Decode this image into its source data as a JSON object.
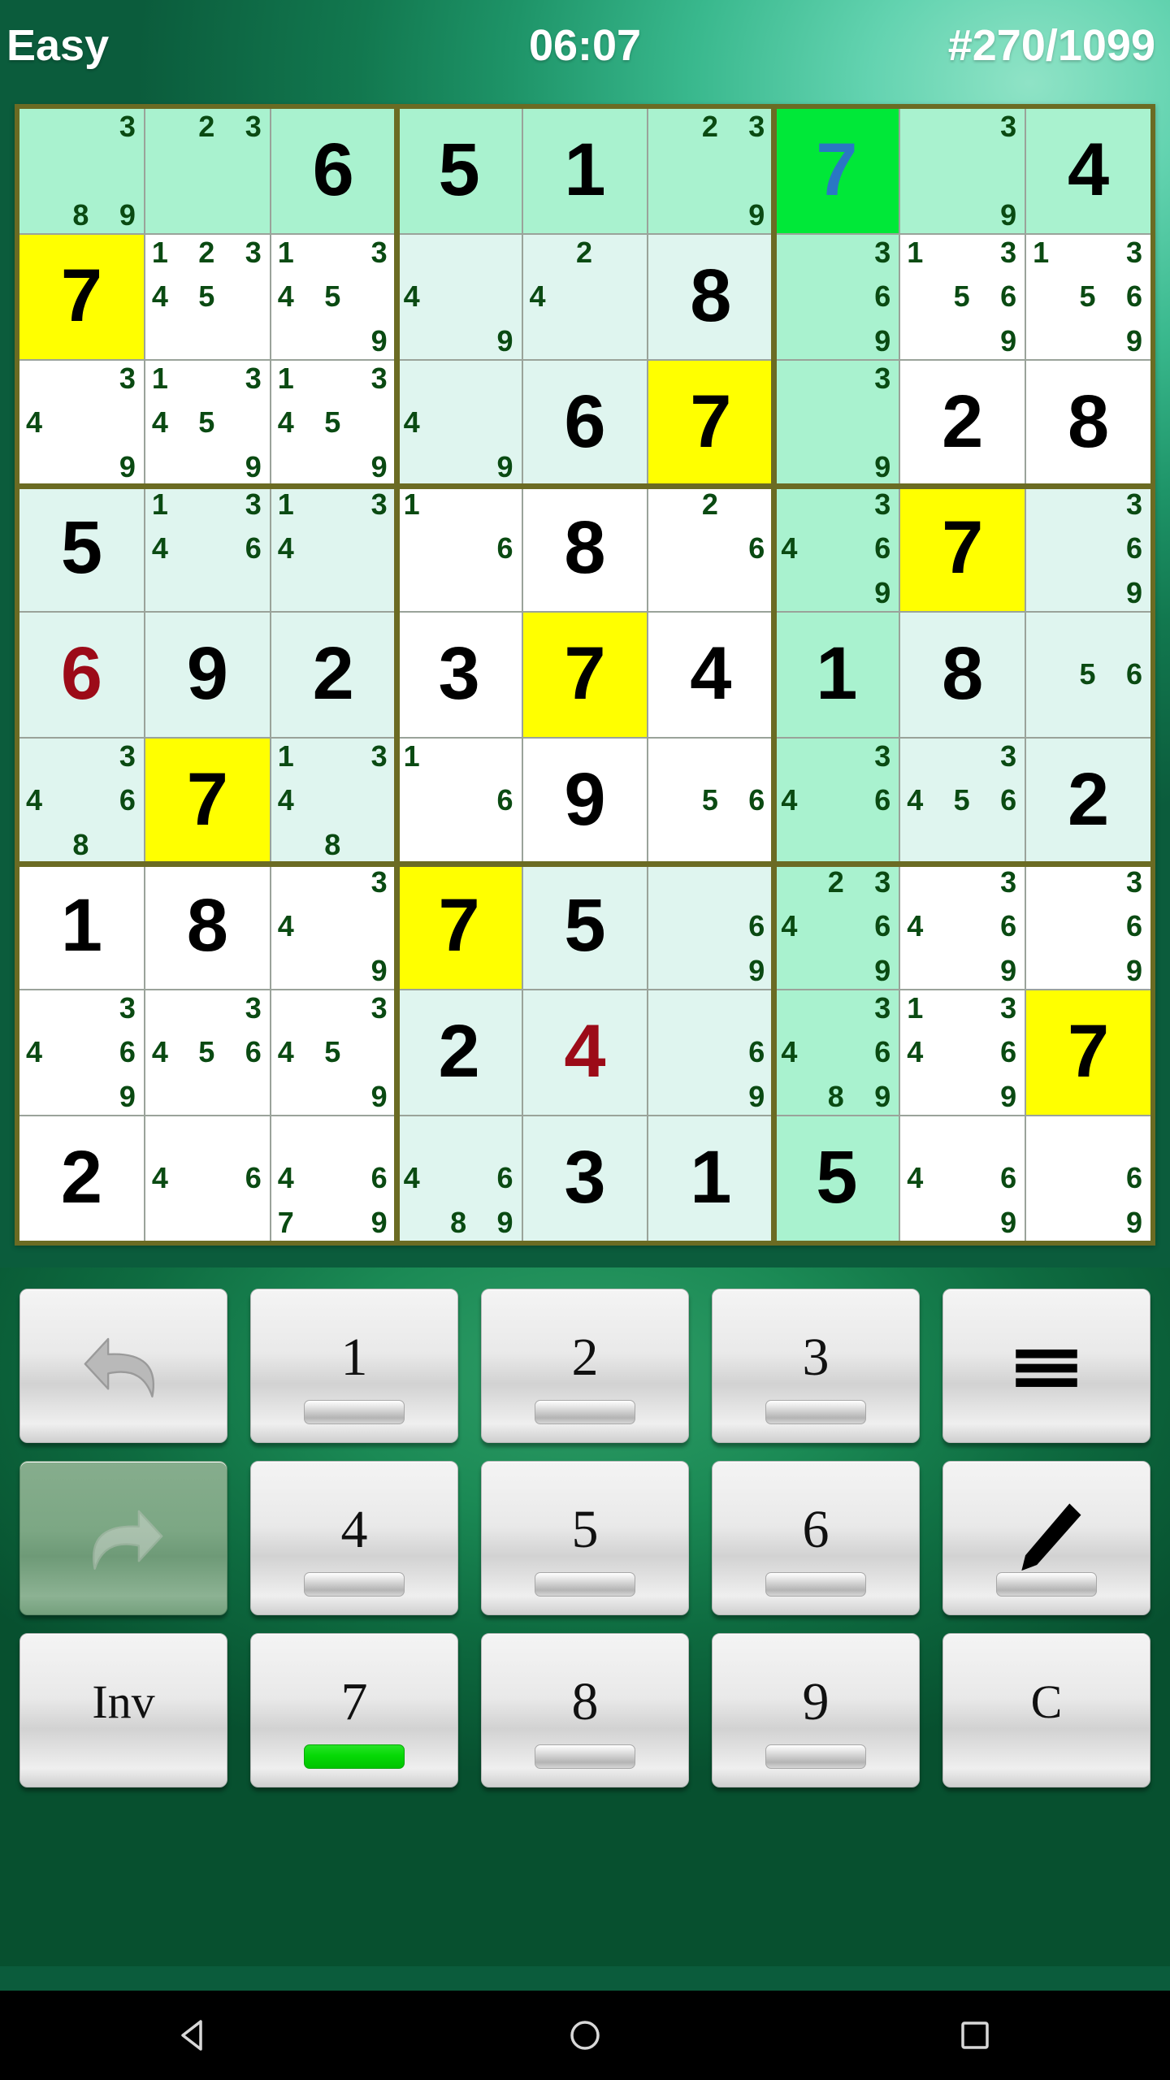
{
  "header": {
    "difficulty": "Easy",
    "timer": "06:07",
    "puzzle_id": "#270/1099"
  },
  "colors": {
    "selected_cell_bg": "#00e838",
    "selected_number": "#2a77c4",
    "highlight_yellow": "#ffff00",
    "error_red": "#9c0b18",
    "pencil_green": "#0a4a12",
    "peer_light": "#dff5ef",
    "peer_strong": "#a9f2cf",
    "board_border": "#6b6b23",
    "active_keypad_bar": "#00c400"
  },
  "board": {
    "rows": [
      [
        {
          "marks": [
            3,
            8,
            9
          ],
          "bg": "hl2"
        },
        {
          "marks": [
            2,
            3
          ],
          "bg": "hl2"
        },
        {
          "value": 6,
          "bg": "hl2"
        },
        {
          "value": 5,
          "bg": "hl2"
        },
        {
          "value": 1,
          "bg": "hl2"
        },
        {
          "marks": [
            2,
            3,
            9
          ],
          "bg": "hl2"
        },
        {
          "value": 7,
          "bg": "sel",
          "style": "selnum"
        },
        {
          "marks": [
            3,
            9
          ],
          "bg": "hl2"
        },
        {
          "value": 4,
          "bg": "hl2"
        }
      ],
      [
        {
          "value": 7,
          "bg": "yellow"
        },
        {
          "marks": [
            1,
            2,
            3,
            4,
            5
          ],
          "bg": "plain"
        },
        {
          "marks": [
            1,
            3,
            4,
            5,
            9
          ],
          "bg": "plain"
        },
        {
          "marks": [
            4,
            9
          ],
          "bg": "hl"
        },
        {
          "marks": [
            2,
            4
          ],
          "bg": "hl"
        },
        {
          "value": 8,
          "bg": "hl"
        },
        {
          "marks": [
            3,
            6,
            9
          ],
          "bg": "hl2"
        },
        {
          "marks": [
            1,
            3,
            5,
            6,
            9
          ],
          "bg": "plain"
        },
        {
          "marks": [
            1,
            3,
            5,
            6,
            9
          ],
          "bg": "plain"
        }
      ],
      [
        {
          "marks": [
            3,
            4,
            9
          ],
          "bg": "plain"
        },
        {
          "marks": [
            1,
            3,
            4,
            5,
            9
          ],
          "bg": "plain"
        },
        {
          "marks": [
            1,
            3,
            4,
            5,
            9
          ],
          "bg": "plain"
        },
        {
          "marks": [
            4,
            9
          ],
          "bg": "hl"
        },
        {
          "value": 6,
          "bg": "hl"
        },
        {
          "value": 7,
          "bg": "yellow"
        },
        {
          "marks": [
            3,
            9
          ],
          "bg": "hl2"
        },
        {
          "value": 2,
          "bg": "plain"
        },
        {
          "value": 8,
          "bg": "plain"
        }
      ],
      [
        {
          "value": 5,
          "bg": "hl"
        },
        {
          "marks": [
            1,
            3,
            4,
            6
          ],
          "bg": "hl"
        },
        {
          "marks": [
            1,
            3,
            4
          ],
          "bg": "hl"
        },
        {
          "marks": [
            1,
            6
          ],
          "bg": "plain"
        },
        {
          "value": 8,
          "bg": "plain"
        },
        {
          "marks": [
            2,
            6
          ],
          "bg": "plain"
        },
        {
          "marks": [
            3,
            4,
            6,
            9
          ],
          "bg": "hl2"
        },
        {
          "value": 7,
          "bg": "yellow"
        },
        {
          "marks": [
            3,
            6,
            9
          ],
          "bg": "hl"
        }
      ],
      [
        {
          "value": 6,
          "bg": "hl",
          "style": "err"
        },
        {
          "value": 9,
          "bg": "hl"
        },
        {
          "value": 2,
          "bg": "hl"
        },
        {
          "value": 3,
          "bg": "plain"
        },
        {
          "value": 7,
          "bg": "yellow"
        },
        {
          "value": 4,
          "bg": "plain"
        },
        {
          "value": 1,
          "bg": "hl2"
        },
        {
          "value": 8,
          "bg": "hl"
        },
        {
          "marks": [
            5,
            6
          ],
          "bg": "hl"
        }
      ],
      [
        {
          "marks": [
            3,
            4,
            6,
            8
          ],
          "bg": "hl"
        },
        {
          "value": 7,
          "bg": "yellow"
        },
        {
          "marks": [
            1,
            3,
            4,
            8
          ],
          "bg": "hl"
        },
        {
          "marks": [
            1,
            6
          ],
          "bg": "plain"
        },
        {
          "value": 9,
          "bg": "plain"
        },
        {
          "marks": [
            5,
            6
          ],
          "bg": "plain"
        },
        {
          "marks": [
            3,
            4,
            6
          ],
          "bg": "hl2"
        },
        {
          "marks": [
            3,
            4,
            5,
            6
          ],
          "bg": "hl"
        },
        {
          "value": 2,
          "bg": "hl"
        }
      ],
      [
        {
          "value": 1,
          "bg": "plain"
        },
        {
          "value": 8,
          "bg": "plain"
        },
        {
          "marks": [
            3,
            4,
            9
          ],
          "bg": "plain"
        },
        {
          "value": 7,
          "bg": "yellow"
        },
        {
          "value": 5,
          "bg": "hl"
        },
        {
          "marks": [
            6,
            9
          ],
          "bg": "hl"
        },
        {
          "marks": [
            2,
            3,
            4,
            6,
            9
          ],
          "bg": "hl2"
        },
        {
          "marks": [
            3,
            4,
            6,
            9
          ],
          "bg": "plain"
        },
        {
          "marks": [
            3,
            6,
            9
          ],
          "bg": "plain"
        }
      ],
      [
        {
          "marks": [
            3,
            4,
            6,
            9
          ],
          "bg": "plain"
        },
        {
          "marks": [
            3,
            4,
            5,
            6
          ],
          "bg": "plain"
        },
        {
          "marks": [
            3,
            4,
            5,
            9
          ],
          "bg": "plain"
        },
        {
          "value": 2,
          "bg": "hl"
        },
        {
          "value": 4,
          "bg": "hl",
          "style": "err"
        },
        {
          "marks": [
            6,
            9
          ],
          "bg": "hl"
        },
        {
          "marks": [
            3,
            4,
            6,
            8,
            9
          ],
          "bg": "hl2"
        },
        {
          "marks": [
            1,
            3,
            4,
            6,
            9
          ],
          "bg": "plain"
        },
        {
          "value": 7,
          "bg": "yellow"
        }
      ],
      [
        {
          "value": 2,
          "bg": "plain"
        },
        {
          "marks": [
            4,
            6
          ],
          "bg": "plain"
        },
        {
          "marks": [
            4,
            6,
            7,
            9
          ],
          "bg": "plain"
        },
        {
          "marks": [
            4,
            6,
            8,
            9
          ],
          "bg": "hl"
        },
        {
          "value": 3,
          "bg": "hl"
        },
        {
          "value": 1,
          "bg": "hl"
        },
        {
          "value": 5,
          "bg": "hl2"
        },
        {
          "marks": [
            4,
            6,
            9
          ],
          "bg": "plain"
        },
        {
          "marks": [
            6,
            9
          ],
          "bg": "plain"
        }
      ]
    ]
  },
  "keypad": {
    "keys": [
      {
        "name": "undo-button",
        "type": "icon",
        "icon": "undo-arrow-icon",
        "label": "",
        "bar": "none",
        "dim": false
      },
      {
        "name": "digit-1-button",
        "type": "digit",
        "icon": "",
        "label": "1",
        "bar": "off",
        "dim": false
      },
      {
        "name": "digit-2-button",
        "type": "digit",
        "icon": "",
        "label": "2",
        "bar": "off",
        "dim": false
      },
      {
        "name": "digit-3-button",
        "type": "digit",
        "icon": "",
        "label": "3",
        "bar": "off",
        "dim": false
      },
      {
        "name": "menu-button",
        "type": "icon",
        "icon": "hamburger-menu-icon",
        "label": "",
        "bar": "none",
        "dim": false
      },
      {
        "name": "redo-button",
        "type": "icon",
        "icon": "redo-arrow-icon",
        "label": "",
        "bar": "none",
        "dim": true
      },
      {
        "name": "digit-4-button",
        "type": "digit",
        "icon": "",
        "label": "4",
        "bar": "off",
        "dim": false
      },
      {
        "name": "digit-5-button",
        "type": "digit",
        "icon": "",
        "label": "5",
        "bar": "off",
        "dim": false
      },
      {
        "name": "digit-6-button",
        "type": "digit",
        "icon": "",
        "label": "6",
        "bar": "off",
        "dim": false
      },
      {
        "name": "pencil-mode-button",
        "type": "icon",
        "icon": "pencil-icon",
        "label": "",
        "bar": "off",
        "dim": false
      },
      {
        "name": "invert-button",
        "type": "text",
        "icon": "",
        "label": "Inv",
        "bar": "none",
        "dim": false
      },
      {
        "name": "digit-7-button",
        "type": "digit",
        "icon": "",
        "label": "7",
        "bar": "on",
        "dim": false
      },
      {
        "name": "digit-8-button",
        "type": "digit",
        "icon": "",
        "label": "8",
        "bar": "off",
        "dim": false
      },
      {
        "name": "digit-9-button",
        "type": "digit",
        "icon": "",
        "label": "9",
        "bar": "off",
        "dim": false
      },
      {
        "name": "clear-button",
        "type": "text",
        "icon": "",
        "label": "C",
        "bar": "none",
        "dim": false
      }
    ]
  },
  "navbar": {
    "back": "back-triangle-icon",
    "home": "home-circle-icon",
    "recents": "recents-square-icon"
  }
}
